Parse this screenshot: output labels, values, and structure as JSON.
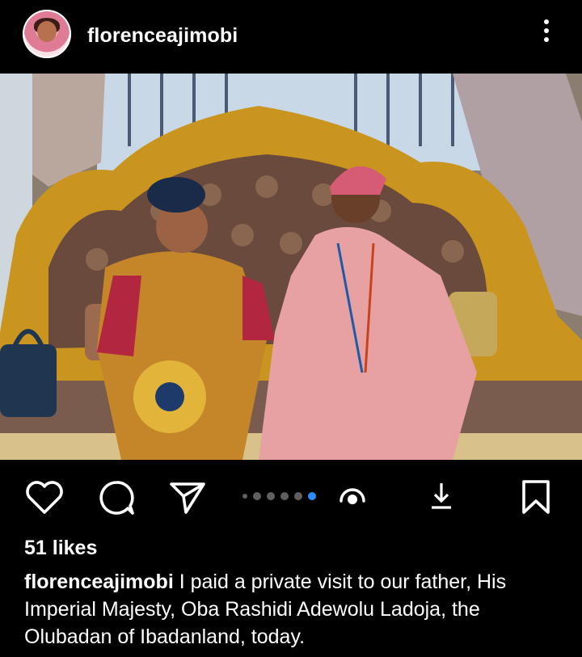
{
  "post": {
    "username": "florenceajimobi",
    "likes": "51 likes",
    "caption_user": "florenceajimobi",
    "caption_text": "I paid a private visit to our father, His Imperial Majesty, Oba Rashidi Adewolu Ladoja, the Olubadan of Ibadanland, today.",
    "carousel": {
      "total": 6,
      "current": 6
    }
  },
  "icons": {
    "more": "more-vertical-icon",
    "like": "heart-icon",
    "comment": "comment-icon",
    "share": "send-icon",
    "reel": "reel-icon",
    "download": "download-icon",
    "save": "bookmark-icon"
  },
  "colors": {
    "background": "#000000",
    "text": "#ffffff",
    "carousel_active": "#2b8cff",
    "carousel_inactive": "#5f5f5f"
  }
}
